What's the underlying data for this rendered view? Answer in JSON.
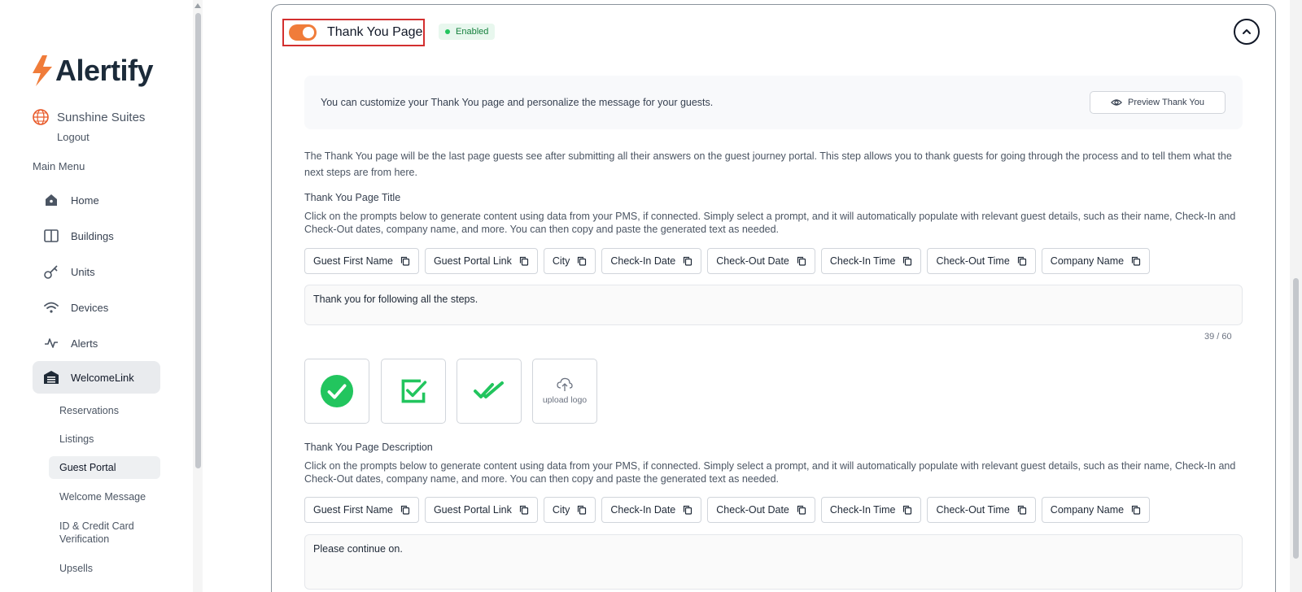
{
  "sidebar": {
    "brand": "Alertify",
    "property_name": "Sunshine Suites",
    "logout": "Logout",
    "main_menu": "Main Menu",
    "items": [
      {
        "label": "Home",
        "icon": "home-icon"
      },
      {
        "label": "Buildings",
        "icon": "book-icon"
      },
      {
        "label": "Units",
        "icon": "key-icon"
      },
      {
        "label": "Devices",
        "icon": "wifi-icon"
      },
      {
        "label": "Alerts",
        "icon": "activity-icon"
      },
      {
        "label": "WelcomeLink",
        "icon": "warehouse-icon",
        "active": true
      }
    ],
    "sub_items": [
      {
        "label": "Reservations"
      },
      {
        "label": "Listings"
      },
      {
        "label": "Guest Portal",
        "active": true
      },
      {
        "label": "Welcome Message"
      },
      {
        "label": "ID & Credit Card Verification"
      },
      {
        "label": "Upsells"
      }
    ]
  },
  "section": {
    "title": "Thank You Page",
    "status": "Enabled",
    "toggle_on": true,
    "info_text": "You can customize your Thank You page and personalize the message for your guests.",
    "preview_button": "Preview Thank You",
    "description": "The Thank You page will be the last page guests see after submitting all their answers on the guest journey portal. This step allows you to thank guests for going through the process and to tell them what the next steps are from here.",
    "title_field": {
      "label": "Thank You Page Title",
      "helper": "Click on the prompts below to generate content using data from your PMS, if connected. Simply select a prompt, and it will automatically populate with relevant guest details, such as their name, Check-In and Check-Out dates, company name, and more. You can then copy and paste the generated text as needed.",
      "value": "Thank you for following all the steps.",
      "counter": "39 / 60"
    },
    "prompts": [
      "Guest First Name",
      "Guest Portal Link",
      "City",
      "Check-In Date",
      "Check-Out Date",
      "Check-In Time",
      "Check-Out Time",
      "Company Name"
    ],
    "icons": [
      {
        "name": "check-circle-icon"
      },
      {
        "name": "check-square-icon"
      },
      {
        "name": "double-check-icon"
      },
      {
        "name": "upload-logo-icon",
        "label": "upload logo"
      }
    ],
    "description_field": {
      "label": "Thank You Page Description",
      "helper": "Click on the prompts below to generate content using data from your PMS, if connected. Simply select a prompt, and it will automatically populate with relevant guest details, such as their name, Check-In and Check-Out dates, company name, and more. You can then copy and paste the generated text as needed.",
      "value": "Please continue on."
    }
  },
  "colors": {
    "accent": "#f07c3a",
    "success": "#22c55e",
    "highlight": "#d32f2f"
  }
}
